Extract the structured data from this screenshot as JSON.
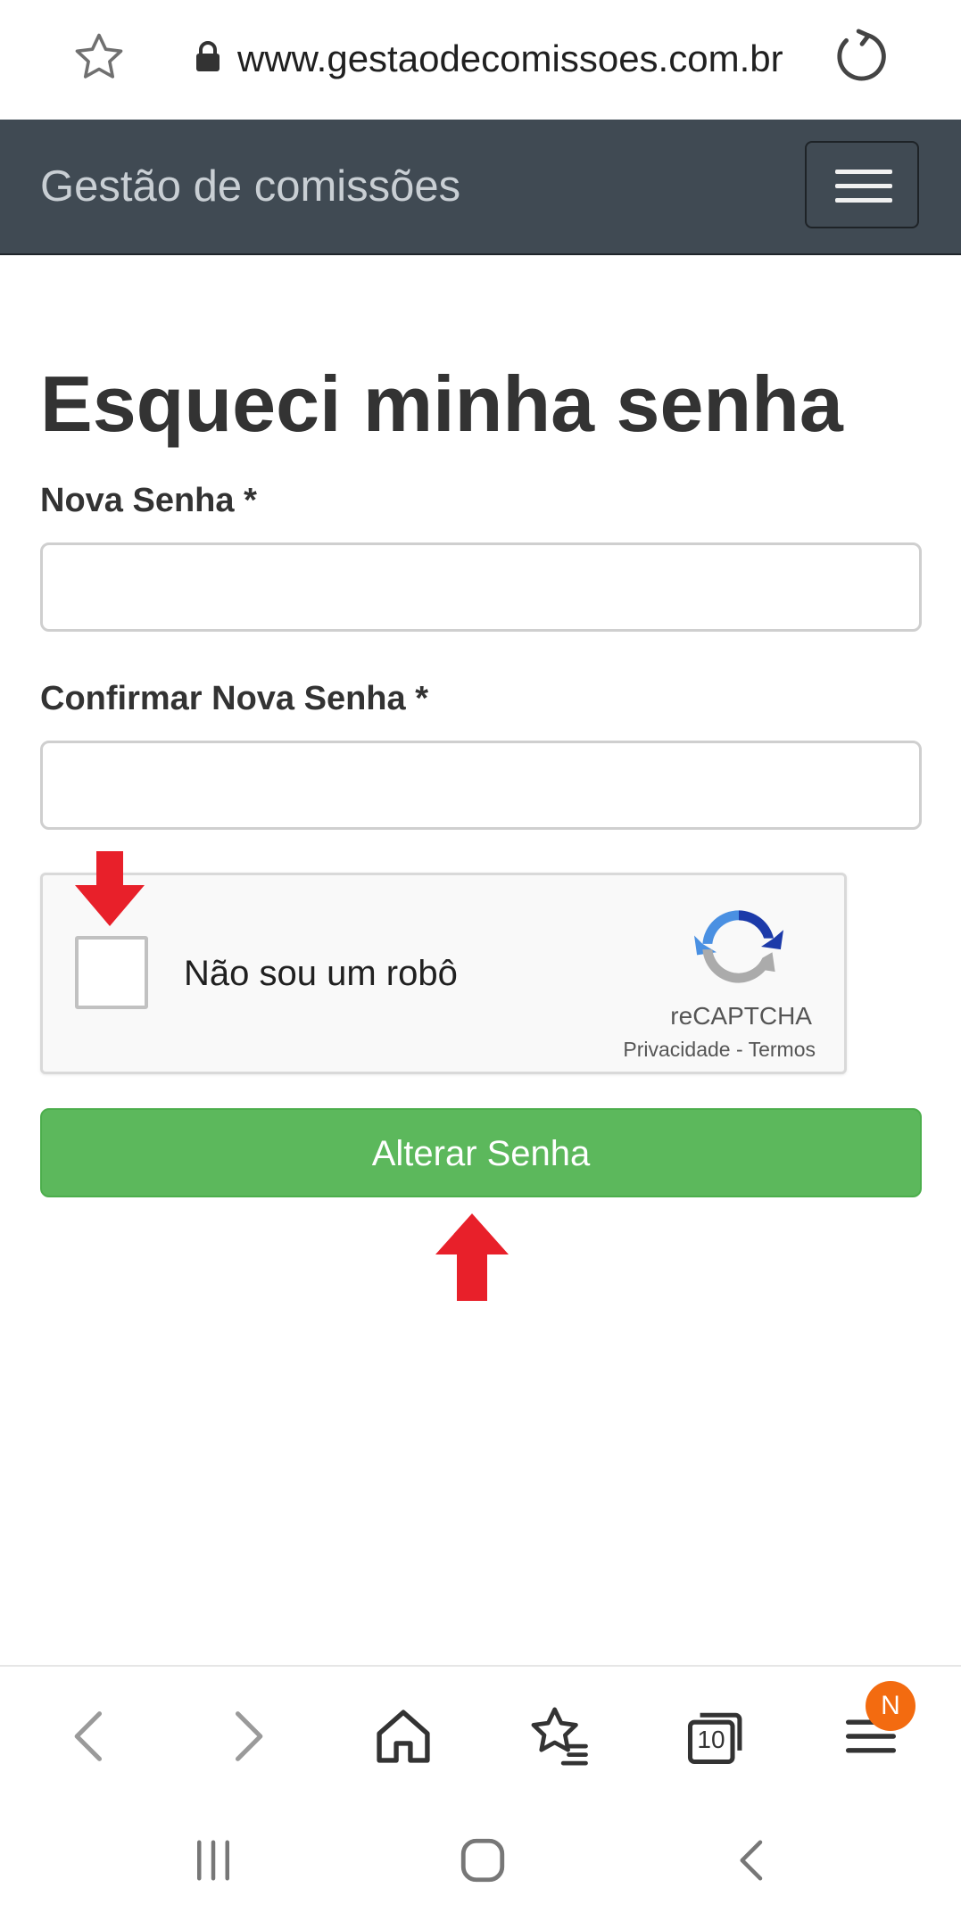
{
  "browser": {
    "url": "www.gestaodecomissoes.com.br",
    "tab_count": "10",
    "menu_badge": "N"
  },
  "navbar": {
    "brand": "Gestão de comissões"
  },
  "form": {
    "title": "Esqueci minha senha",
    "new_password_label": "Nova Senha *",
    "new_password_value": "",
    "confirm_password_label": "Confirmar Nova Senha *",
    "confirm_password_value": "",
    "submit_label": "Alterar Senha"
  },
  "captcha": {
    "label": "Não sou um robô",
    "brand": "reCAPTCHA",
    "links": "Privacidade - Termos"
  },
  "colors": {
    "navbar_bg": "#404a53",
    "submit_bg": "#5cb85c",
    "annotation_arrow": "#e8202a",
    "badge_bg": "#f36b10"
  },
  "icons": {
    "bookmark_star": "star-icon",
    "secure": "lock-icon",
    "reload": "reload-icon",
    "menu": "hamburger-icon",
    "back": "chevron-left-icon",
    "forward": "chevron-right-icon",
    "home": "home-icon",
    "bookmarks": "bookmarks-icon",
    "tabs": "tabs-icon",
    "browser_menu": "menu-icon"
  }
}
